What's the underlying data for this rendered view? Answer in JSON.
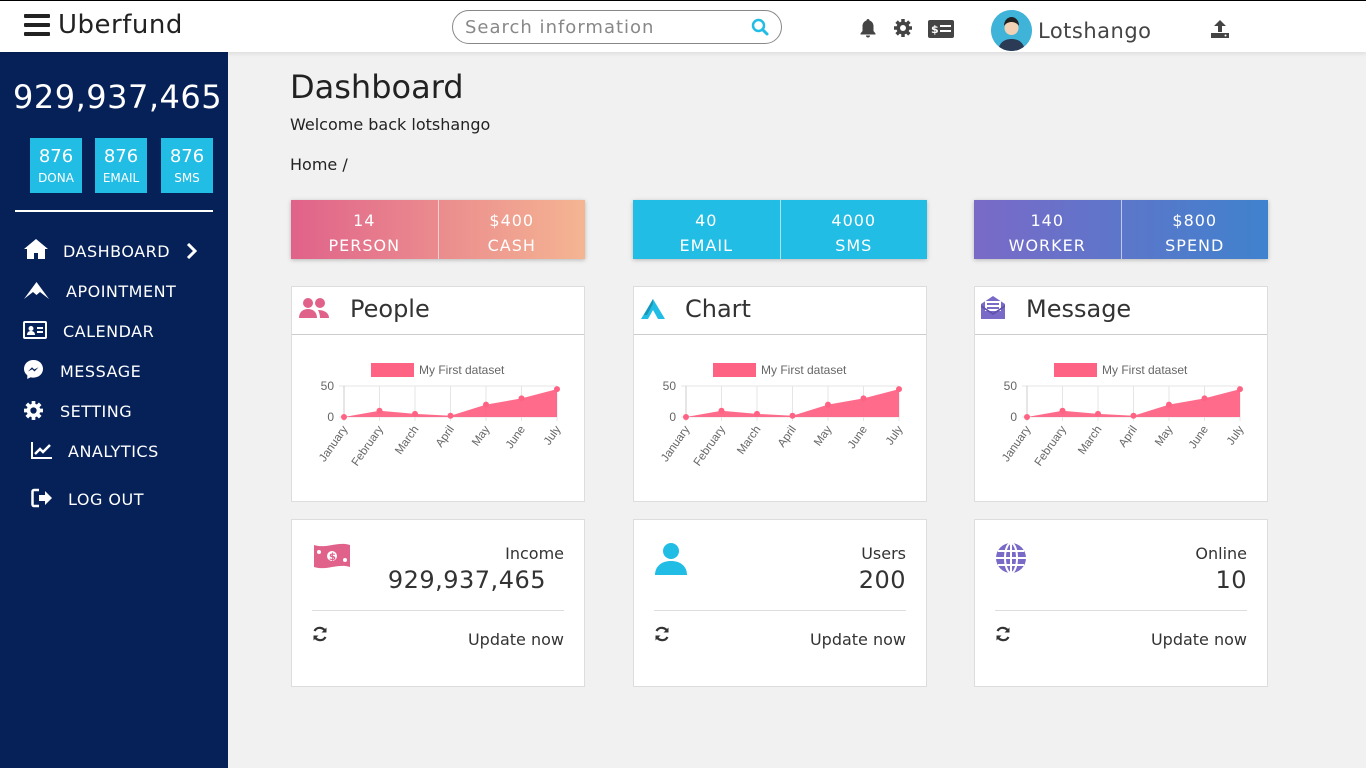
{
  "brand": {
    "name": "Uberfund"
  },
  "search": {
    "placeholder": "Search information"
  },
  "user": {
    "name": "Lotshango"
  },
  "sidebar": {
    "total": "929,937,465",
    "minis": [
      {
        "value": "876",
        "label": "DONA"
      },
      {
        "value": "876",
        "label": "EMAIL"
      },
      {
        "value": "876",
        "label": "SMS"
      }
    ],
    "nav": [
      {
        "label": "DASHBOARD",
        "icon": "home-icon"
      },
      {
        "label": "APOINTMENT",
        "icon": "mountain-icon"
      },
      {
        "label": "CALENDAR",
        "icon": "id-card-icon"
      },
      {
        "label": "MESSAGE",
        "icon": "messenger-icon"
      },
      {
        "label": "SETTING",
        "icon": "gear-icon"
      },
      {
        "label": "ANALYTICS",
        "icon": "chart-line-icon"
      },
      {
        "label": "LOG OUT",
        "icon": "sign-out-icon"
      }
    ]
  },
  "page": {
    "title": "Dashboard",
    "welcome": "Welcome back lotshango",
    "breadcrumb_home": "Home",
    "breadcrumb_sep": "/"
  },
  "stats": [
    {
      "a_value": "14",
      "a_label": "PERSON",
      "b_value": "$400",
      "b_label": "CASH"
    },
    {
      "a_value": "40",
      "a_label": "EMAIL",
      "b_value": "4000",
      "b_label": "SMS"
    },
    {
      "a_value": "140",
      "a_label": "WORKER",
      "b_value": "$800",
      "b_label": "SPEND"
    }
  ],
  "chart_cards": [
    {
      "title": "People",
      "icon": "users-icon",
      "icon_color": "#e0628a"
    },
    {
      "title": "Chart",
      "icon": "logo-a-icon",
      "icon_color": "#22bde5"
    },
    {
      "title": "Message",
      "icon": "envelope-open-icon",
      "icon_color": "#7a6ac7"
    }
  ],
  "info_cards": [
    {
      "label": "Income",
      "value": "929,937,465",
      "update": "Update now",
      "icon": "money-bill-icon",
      "icon_color": "#e0628a"
    },
    {
      "label": "Users",
      "value": "200",
      "update": "Update now",
      "icon": "user-icon",
      "icon_color": "#22bde5"
    },
    {
      "label": "Online",
      "value": "10",
      "update": "Update now",
      "icon": "globe-icon",
      "icon_color": "#7a6ac7"
    }
  ],
  "chart_data": [
    {
      "type": "area",
      "categories": [
        "January",
        "February",
        "March",
        "April",
        "May",
        "June",
        "July"
      ],
      "series": [
        {
          "name": "My First dataset",
          "values": [
            0,
            10,
            5,
            2,
            20,
            30,
            45
          ],
          "color": "#ff6384"
        }
      ],
      "yticks": [
        0,
        50
      ],
      "ylim": [
        0,
        50
      ],
      "legend": "top"
    },
    {
      "type": "area",
      "categories": [
        "January",
        "February",
        "March",
        "April",
        "May",
        "June",
        "July"
      ],
      "series": [
        {
          "name": "My First dataset",
          "values": [
            0,
            10,
            5,
            2,
            20,
            30,
            45
          ],
          "color": "#ff6384"
        }
      ],
      "yticks": [
        0,
        50
      ],
      "ylim": [
        0,
        50
      ],
      "legend": "top"
    },
    {
      "type": "area",
      "categories": [
        "January",
        "February",
        "March",
        "April",
        "May",
        "June",
        "July"
      ],
      "series": [
        {
          "name": "My First dataset",
          "values": [
            0,
            10,
            5,
            2,
            20,
            30,
            45
          ],
          "color": "#ff6384"
        }
      ],
      "yticks": [
        0,
        50
      ],
      "ylim": [
        0,
        50
      ],
      "legend": "top"
    }
  ],
  "colors": {
    "sidebar": "#062158",
    "accent": "#22bde5",
    "chart": "#ff6384"
  }
}
